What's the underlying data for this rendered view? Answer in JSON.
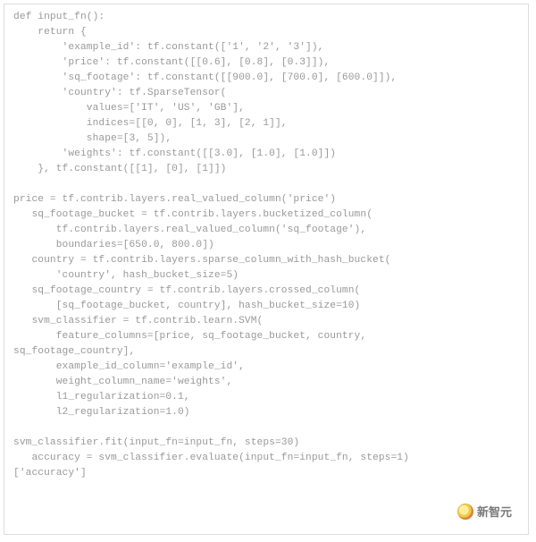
{
  "code": {
    "lines": [
      "def input_fn():",
      "    return {",
      "        'example_id': tf.constant(['1', '2', '3']),",
      "        'price': tf.constant([[0.6], [0.8], [0.3]]),",
      "        'sq_footage': tf.constant([[900.0], [700.0], [600.0]]),",
      "        'country': tf.SparseTensor(",
      "            values=['IT', 'US', 'GB'],",
      "            indices=[[0, 0], [1, 3], [2, 1]],",
      "            shape=[3, 5]),",
      "        'weights': tf.constant([[3.0], [1.0], [1.0]])",
      "    }, tf.constant([[1], [0], [1]])",
      "",
      "price = tf.contrib.layers.real_valued_column('price')",
      "   sq_footage_bucket = tf.contrib.layers.bucketized_column(",
      "       tf.contrib.layers.real_valued_column('sq_footage'),",
      "       boundaries=[650.0, 800.0])",
      "   country = tf.contrib.layers.sparse_column_with_hash_bucket(",
      "       'country', hash_bucket_size=5)",
      "   sq_footage_country = tf.contrib.layers.crossed_column(",
      "       [sq_footage_bucket, country], hash_bucket_size=10)",
      "   svm_classifier = tf.contrib.learn.SVM(",
      "       feature_columns=[price, sq_footage_bucket, country,",
      "sq_footage_country],",
      "       example_id_column='example_id',",
      "       weight_column_name='weights',",
      "       l1_regularization=0.1,",
      "       l2_regularization=1.0)",
      "",
      "svm_classifier.fit(input_fn=input_fn, steps=30)",
      "   accuracy = svm_classifier.evaluate(input_fn=input_fn, steps=1)",
      "['accuracy']"
    ]
  },
  "watermark": {
    "text": "新智元"
  }
}
